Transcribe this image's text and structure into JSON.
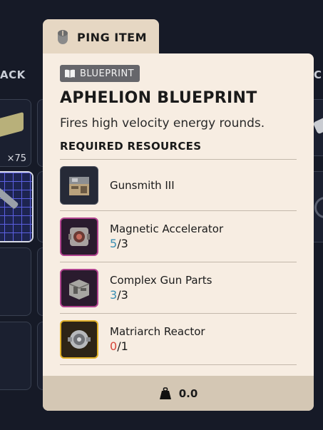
{
  "background": {
    "left_label": "ACK",
    "right_label": "C",
    "slot_count": "×75"
  },
  "ping": {
    "label": "PING ITEM",
    "icon": "mouse-icon"
  },
  "tooltip": {
    "badge": "BLUEPRINT",
    "badge_icon": "book-icon",
    "title": "APHELION BLUEPRINT",
    "description": "Fires high velocity energy rounds.",
    "required_header": "REQUIRED RESOURCES",
    "resources": [
      {
        "name": "Gunsmith III",
        "have": "",
        "sep": "",
        "need": "",
        "rarity": "common",
        "icon": "workbench-icon"
      },
      {
        "name": "Magnetic Accelerator",
        "have": "5",
        "sep": "/",
        "need": "3",
        "rarity": "epic",
        "icon": "accelerator-icon"
      },
      {
        "name": "Complex Gun Parts",
        "have": "3",
        "sep": "/",
        "need": "3",
        "rarity": "epic",
        "icon": "gun-parts-icon"
      },
      {
        "name": "Matriarch Reactor",
        "have": "0",
        "sep": "/",
        "need": "1",
        "rarity": "legendary",
        "icon": "reactor-icon"
      }
    ],
    "weight": "0.0",
    "weight_icon": "weight-icon"
  },
  "colors": {
    "card_bg": "#f7ede2",
    "have_ok": "#3a8fb3",
    "have_short": "#d6463b",
    "epic": "#b0438f",
    "legendary": "#e0b12a"
  }
}
